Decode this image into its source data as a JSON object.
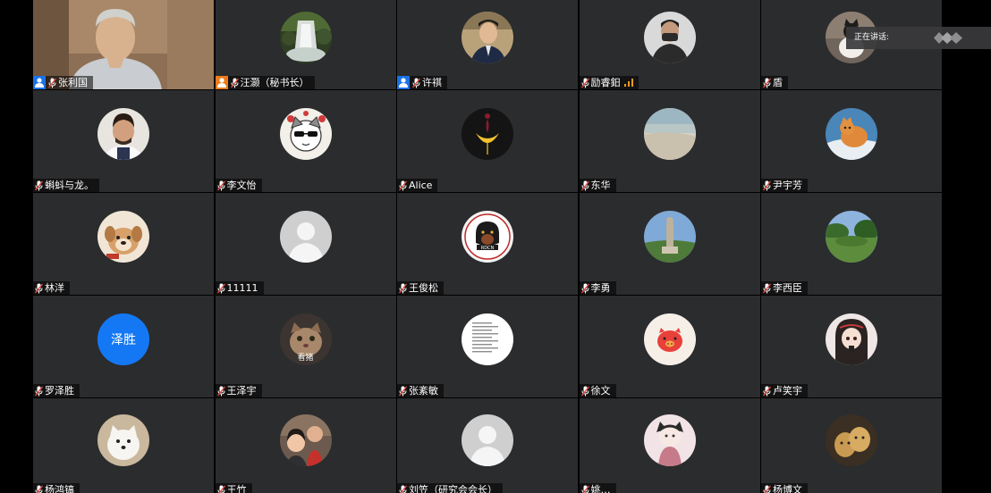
{
  "speaking": {
    "label": "正在讲话:"
  },
  "participants": [
    {
      "name": "张利国",
      "role": "co-host",
      "avatar": "video-feed"
    },
    {
      "name": "汪灏（秘书长）",
      "role": "host",
      "avatar": "waterfall-photo"
    },
    {
      "name": "许祺",
      "role": "co-host",
      "avatar": "man-in-suit-photo"
    },
    {
      "name": "励睿鈤",
      "avatar": "masked-man-photo",
      "signal": true
    },
    {
      "name": "盾",
      "avatar": "cat-photo"
    },
    {
      "name": "蝌蚪与龙。",
      "avatar": "man-portrait-photo"
    },
    {
      "name": "李文怡",
      "avatar": "cartoon-cat-sunglasses"
    },
    {
      "name": "Alice",
      "avatar": "ginkgo-leaf-art"
    },
    {
      "name": "东华",
      "avatar": "beach-photo"
    },
    {
      "name": "尹宇芳",
      "avatar": "orange-cat-photo"
    },
    {
      "name": "林洋",
      "avatar": "puppy-photo"
    },
    {
      "name": "11111",
      "avatar": "default-avatar"
    },
    {
      "name": "王俊松",
      "avatar": "dog-logo"
    },
    {
      "name": "李勇",
      "avatar": "statue-photo"
    },
    {
      "name": "李西臣",
      "avatar": "landscape-photo"
    },
    {
      "name": "罗泽胜",
      "avatar": "text-avatar",
      "avatar_text": "泽胜"
    },
    {
      "name": "王泽宇",
      "avatar": "cat-face-photo",
      "avatar_caption": "看猪"
    },
    {
      "name": "张紊敏",
      "avatar": "document-image"
    },
    {
      "name": "徐文",
      "avatar": "pink-cartoon-pig"
    },
    {
      "name": "卢笑宇",
      "avatar": "anime-girl"
    },
    {
      "name": "杨鸿镐",
      "avatar": "white-dog-photo"
    },
    {
      "name": "王竹",
      "avatar": "children-photo"
    },
    {
      "name": "刘笠（研究会会长）",
      "avatar": "default-avatar"
    },
    {
      "name": "姚…",
      "avatar": "anime-cat-girl"
    },
    {
      "name": "杨博文",
      "avatar": "cats-photo"
    }
  ]
}
